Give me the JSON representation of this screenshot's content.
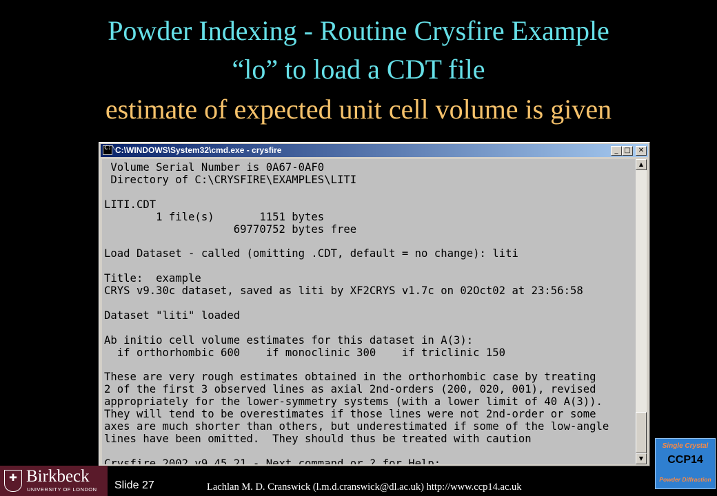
{
  "slide": {
    "title_lines": [
      "Powder Indexing - Routine Crysfire Example",
      "“lo” to load a CDT file",
      "estimate of expected unit cell volume is given"
    ],
    "slide_number": "Slide 27",
    "footer": "Lachlan M. D. Cranswick (l.m.d.cranswick@dl.ac.uk) http://www.ccp14.ac.uk",
    "colors": {
      "title": "#66e0e8",
      "subtitle": "#f6c26b",
      "background": "#000000"
    }
  },
  "window": {
    "title": "C:\\WINDOWS\\System32\\cmd.exe - crysfire",
    "icons": {
      "app": "cmd-icon",
      "minimize": "minimize-icon",
      "maximize": "maximize-icon",
      "close": "close-icon"
    },
    "console_text": " Volume Serial Number is 0A67-0AF0\n Directory of C:\\CRYSFIRE\\EXAMPLES\\LITI\n\nLITI.CDT\n        1 file(s)       1151 bytes\n                    69770752 bytes free\n\nLoad Dataset - called (omitting .CDT, default = no change): liti\n\nTitle:  example\nCRYS v9.30c dataset, saved as liti by XF2CRYS v1.7c on 02Oct02 at 23:56:58\n\nDataset \"liti\" loaded\n\nAb initio cell volume estimates for this dataset in A(3):\n  if orthorhombic 600    if monoclinic 300    if triclinic 150\n\nThese are very rough estimates obtained in the orthorhombic case by treating\n2 of the first 3 observed lines as axial 2nd-orders (200, 020, 001), revised\nappropriately for the lower-symmetry systems (with a lower limit of 40 A(3)).\nThey will tend to be overestimates if those lines were not 2nd-order or some\naxes are much shorter than others, but underestimated if some of the low-angle\nlines have been omitted.  They should thus be treated with caution\n\nCrysfire 2002 v9.45.21 - Next command or ? for Help:"
  },
  "logos": {
    "birkbeck": {
      "name": "Birkbeck",
      "subtitle": "UNIVERSITY OF LONDON"
    },
    "ccp14": {
      "line1": "Single Crystal",
      "line2": "CCP14",
      "line3": "Powder Diffraction"
    }
  }
}
